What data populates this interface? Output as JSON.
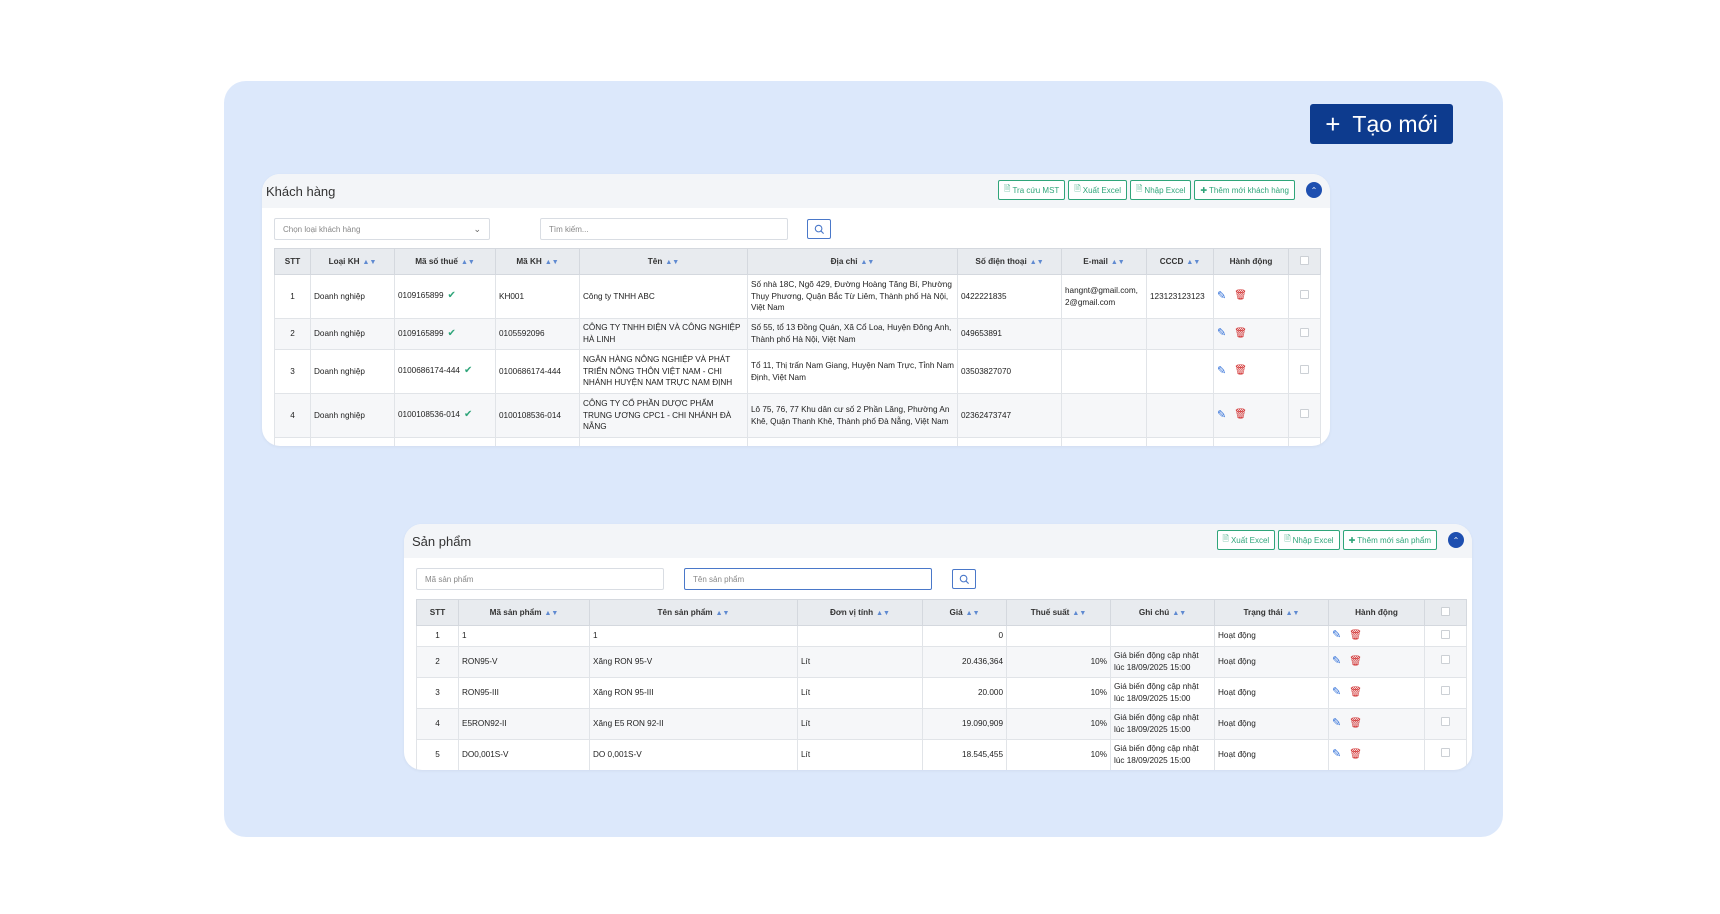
{
  "create_button": {
    "label": "Tạo mới"
  },
  "customers": {
    "title": "Khách hàng",
    "actions": [
      "Tra cứu MST",
      "Xuất Excel",
      "Nhập Excel",
      "Thêm mới khách hàng"
    ],
    "type_select": "Chọn loại khách hàng",
    "search_placeholder": "Tìm kiếm...",
    "columns": [
      "STT",
      "Loại KH",
      "Mã số thuế",
      "Mã KH",
      "Tên",
      "Địa chỉ",
      "Số điện thoại",
      "E-mail",
      "CCCD",
      "Hành động"
    ],
    "rows": [
      {
        "stt": "1",
        "type": "Doanh nghiệp",
        "tax": "0109165899",
        "code": "KH001",
        "name": "Công ty TNHH ABC",
        "address": "Số nhà 18C, Ngõ 429, Đường Hoàng Tăng Bí, Phường Thụy Phương, Quận Bắc Từ Liêm, Thành phố Hà Nội, Việt Nam",
        "phone": "0422221835",
        "email": "hangnt@gmail.com, 2@gmail.com",
        "cccd": "123123123123"
      },
      {
        "stt": "2",
        "type": "Doanh nghiệp",
        "tax": "0109165899",
        "code": "0105592096",
        "name": "CÔNG TY TNHH ĐIỆN VÀ CÔNG NGHIỆP HÀ LINH",
        "address": "Số 55, tổ 13 Đồng Quán, Xã Cổ Loa, Huyện Đông Anh, Thành phố Hà Nội, Việt Nam",
        "phone": "049653891",
        "email": "",
        "cccd": ""
      },
      {
        "stt": "3",
        "type": "Doanh nghiệp",
        "tax": "0100686174-444",
        "code": "0100686174-444",
        "name": "NGÂN HÀNG NÔNG NGHIỆP VÀ PHÁT TRIỂN NÔNG THÔN VIỆT NAM - CHI NHÁNH HUYỆN NAM TRỰC NAM ĐỊNH",
        "address": "Tổ 11, Thị trấn Nam Giang, Huyện Nam Trực, Tỉnh Nam Định, Việt Nam",
        "phone": "03503827070",
        "email": "",
        "cccd": ""
      },
      {
        "stt": "4",
        "type": "Doanh nghiệp",
        "tax": "0100108536-014",
        "code": "0100108536-014",
        "name": "CÔNG TY CỔ PHẦN DƯỢC PHẨM TRUNG ƯƠNG CPC1 - CHI NHÁNH ĐÀ NẴNG",
        "address": "Lô 75, 76, 77 Khu dân cư số 2 Phần Lăng, Phường An Khê, Quận Thanh Khê, Thành phố Đà Nẵng, Việt Nam",
        "phone": "02362473747",
        "email": "",
        "cccd": ""
      }
    ]
  },
  "products": {
    "title": "Sản phẩm",
    "actions": [
      "Xuất Excel",
      "Nhập Excel",
      "Thêm mới sản phẩm"
    ],
    "code_placeholder": "Mã sản phẩm",
    "name_placeholder": "Tên sản phẩm",
    "columns": [
      "STT",
      "Mã sản phẩm",
      "Tên sản phẩm",
      "Đơn vị tính",
      "Giá",
      "Thuế suất",
      "Ghi chú",
      "Trạng thái",
      "Hành động"
    ],
    "rows": [
      {
        "stt": "1",
        "code": "1",
        "name": "1",
        "unit": "",
        "price": "0",
        "tax": "",
        "note": "",
        "status": "Hoạt động"
      },
      {
        "stt": "2",
        "code": "RON95-V",
        "name": "Xăng RON 95-V",
        "unit": "Lít",
        "price": "20.436,364",
        "tax": "10%",
        "note": "Giá biến động cập nhật lúc 18/09/2025 15:00",
        "status": "Hoạt động"
      },
      {
        "stt": "3",
        "code": "RON95-III",
        "name": "Xăng RON 95-III",
        "unit": "Lít",
        "price": "20.000",
        "tax": "10%",
        "note": "Giá biến động cập nhật lúc 18/09/2025 15:00",
        "status": "Hoạt động"
      },
      {
        "stt": "4",
        "code": "E5RON92-II",
        "name": "Xăng E5 RON 92-II",
        "unit": "Lít",
        "price": "19.090,909",
        "tax": "10%",
        "note": "Giá biến động cập nhật lúc 18/09/2025 15:00",
        "status": "Hoạt động"
      },
      {
        "stt": "5",
        "code": "DO0,001S-V",
        "name": "DO 0,001S-V",
        "unit": "Lít",
        "price": "18.545,455",
        "tax": "10%",
        "note": "Giá biến động cập nhật lúc 18/09/2025 15:00",
        "status": "Hoạt động"
      }
    ]
  }
}
